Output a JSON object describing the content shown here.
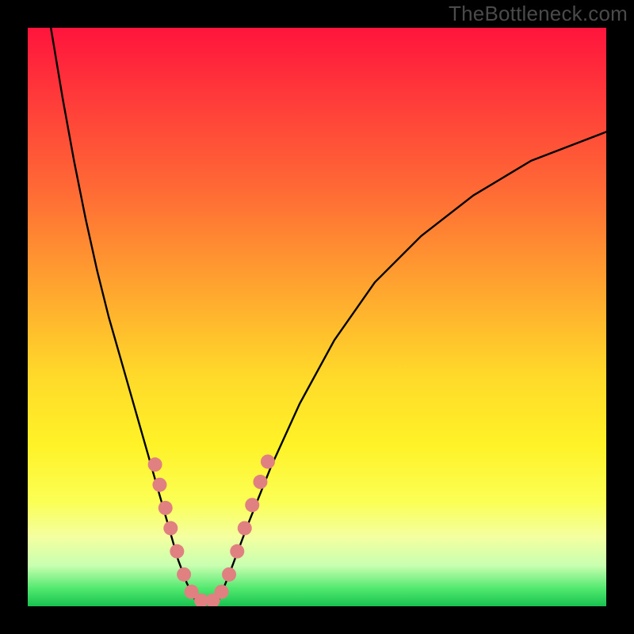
{
  "watermark": "TheBottleneck.com",
  "chart_data": {
    "type": "line",
    "title": "",
    "xlabel": "",
    "ylabel": "",
    "xlim": [
      0,
      100
    ],
    "ylim": [
      0,
      100
    ],
    "series": [
      {
        "name": "left-curve",
        "x": [
          4,
          6,
          8,
          10,
          12,
          14,
          16,
          18,
          20,
          22,
          24,
          26,
          27.5,
          29
        ],
        "y": [
          100,
          88,
          77,
          67,
          58,
          50,
          43,
          36,
          29,
          22,
          15,
          8,
          4,
          1
        ]
      },
      {
        "name": "right-curve",
        "x": [
          33,
          35,
          38,
          42,
          47,
          53,
          60,
          68,
          77,
          87,
          100
        ],
        "y": [
          1,
          6,
          14,
          24,
          35,
          46,
          56,
          64,
          71,
          77,
          82
        ]
      },
      {
        "name": "bottom-flat",
        "x": [
          29,
          33
        ],
        "y": [
          1,
          1
        ]
      }
    ],
    "dot_markers": {
      "name": "pink-dots",
      "color": "#e08080",
      "points": [
        {
          "x": 22.0,
          "y": 24.5
        },
        {
          "x": 22.8,
          "y": 21.0
        },
        {
          "x": 23.8,
          "y": 17.0
        },
        {
          "x": 24.7,
          "y": 13.5
        },
        {
          "x": 25.8,
          "y": 9.5
        },
        {
          "x": 27.0,
          "y": 5.5
        },
        {
          "x": 28.3,
          "y": 2.5
        },
        {
          "x": 30.0,
          "y": 1.0
        },
        {
          "x": 32.0,
          "y": 1.0
        },
        {
          "x": 33.5,
          "y": 2.5
        },
        {
          "x": 34.8,
          "y": 5.5
        },
        {
          "x": 36.2,
          "y": 9.5
        },
        {
          "x": 37.5,
          "y": 13.5
        },
        {
          "x": 38.8,
          "y": 17.5
        },
        {
          "x": 40.2,
          "y": 21.5
        },
        {
          "x": 41.5,
          "y": 25.0
        }
      ]
    },
    "gradient_stops": [
      {
        "pos": 0,
        "color": "#ff143c"
      },
      {
        "pos": 12,
        "color": "#ff3a3a"
      },
      {
        "pos": 28,
        "color": "#ff6a35"
      },
      {
        "pos": 45,
        "color": "#ffa52f"
      },
      {
        "pos": 60,
        "color": "#ffd92a"
      },
      {
        "pos": 72,
        "color": "#fff227"
      },
      {
        "pos": 82,
        "color": "#fbff55"
      },
      {
        "pos": 88,
        "color": "#f4ffa0"
      },
      {
        "pos": 93,
        "color": "#c8ffb0"
      },
      {
        "pos": 97,
        "color": "#50e86e"
      },
      {
        "pos": 100,
        "color": "#18c24f"
      }
    ]
  }
}
